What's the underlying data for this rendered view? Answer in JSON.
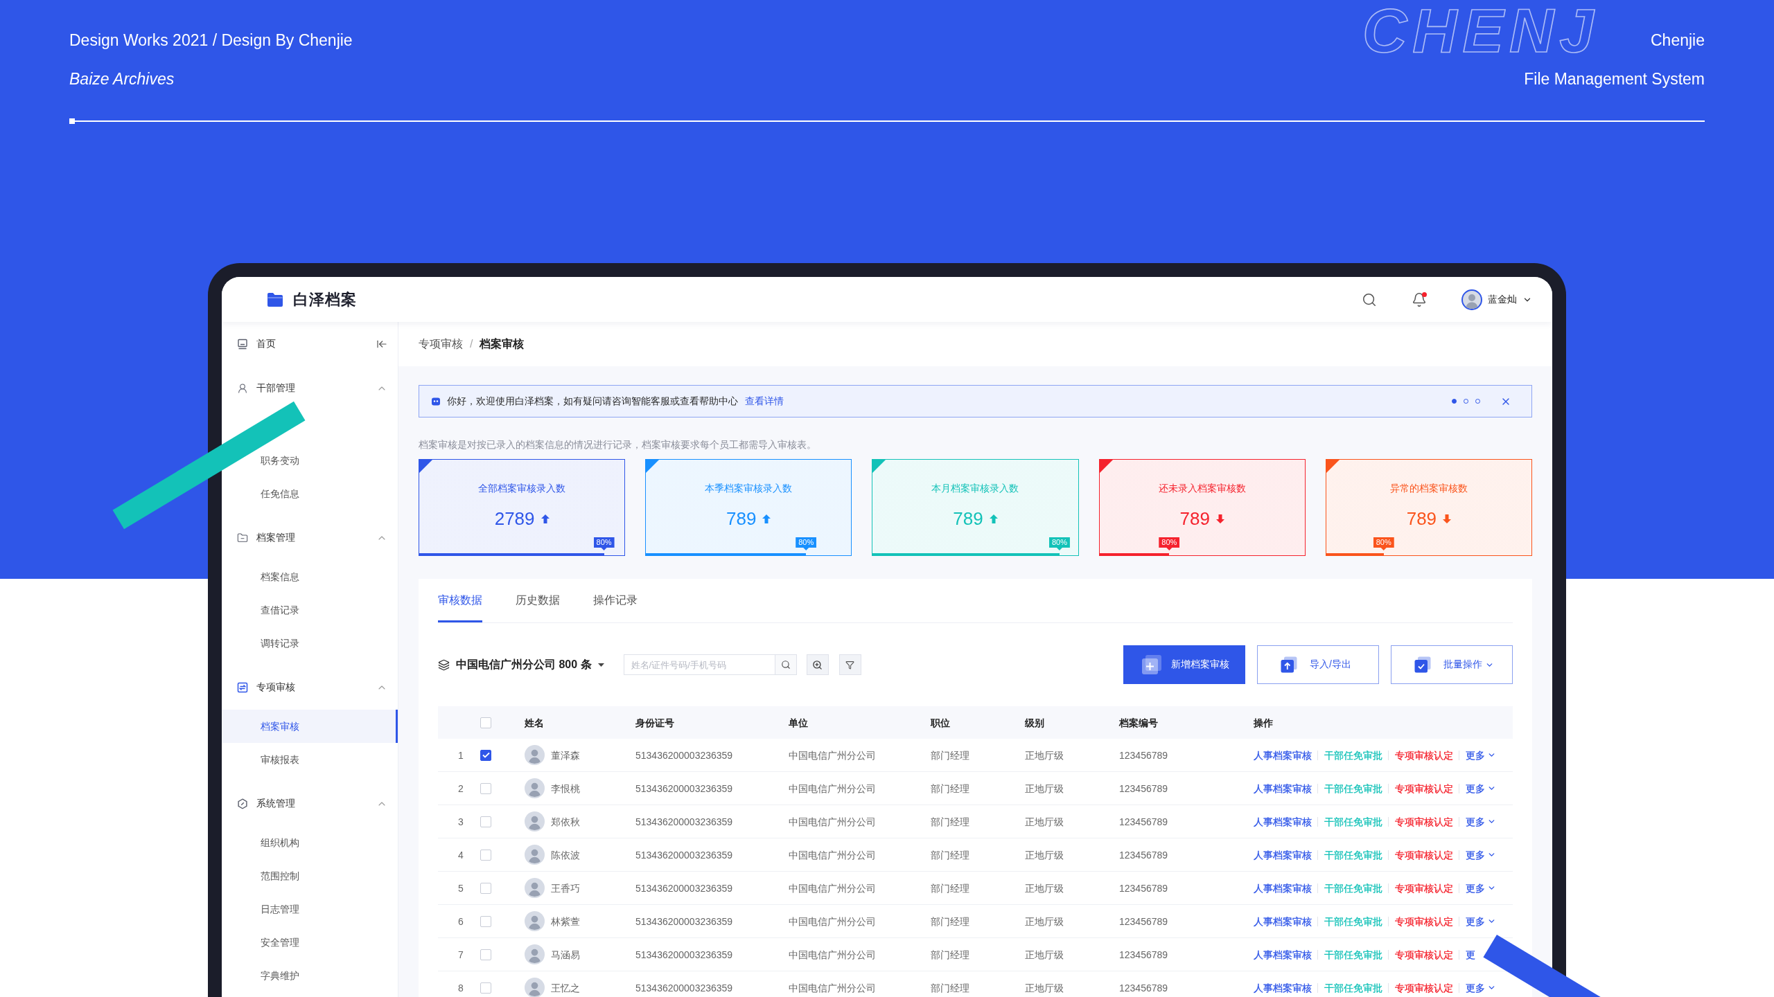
{
  "page_header": {
    "title": "Design Works 2021 / Design By Chenjie",
    "author": "Chenjie",
    "subtitle": "Baize Archives",
    "caption": "File Management System",
    "backdrop_text": "CHENJ"
  },
  "app_header": {
    "logo_text": "白泽档案",
    "has_unread": true,
    "user_name": "蓝金灿"
  },
  "sidebar": {
    "home": "首页",
    "groups": [
      {
        "label": "干部管理",
        "expanded": true,
        "children": [
          {
            "label": "职务变动",
            "selected": false
          },
          {
            "label": "任免信息",
            "selected": false
          }
        ]
      },
      {
        "label": "档案管理",
        "expanded": true,
        "children": [
          {
            "label": "档案信息",
            "selected": false
          },
          {
            "label": "查借记录",
            "selected": false
          },
          {
            "label": "调转记录",
            "selected": false
          }
        ]
      },
      {
        "label": "专项审核",
        "expanded": true,
        "children": [
          {
            "label": "档案审核",
            "selected": true
          },
          {
            "label": "审核报表",
            "selected": false
          }
        ]
      },
      {
        "label": "系统管理",
        "expanded": true,
        "children": [
          {
            "label": "组织机构",
            "selected": false
          },
          {
            "label": "范围控制",
            "selected": false
          },
          {
            "label": "日志管理",
            "selected": false
          },
          {
            "label": "安全管理",
            "selected": false
          },
          {
            "label": "字典维护",
            "selected": false
          }
        ]
      }
    ]
  },
  "breadcrumb": {
    "items": [
      "专项审核",
      "档案审核"
    ],
    "separator": "/"
  },
  "notice": {
    "text": "你好，欢迎使用白泽档案，如有疑问请咨询智能客服或查看帮助中心",
    "link": "查看详情",
    "pages": [
      {
        "selected": true
      },
      {
        "selected": false
      },
      {
        "selected": false
      }
    ]
  },
  "description": "档案审核是对按已录入的档案信息的情况进行记录，档案审核要求每个员工都需导入审核表。",
  "stats": [
    {
      "title": "全部档案审核录入数",
      "value": "2789",
      "rising": true,
      "color": "#2f56e8",
      "level": 0.9,
      "reading": "80%"
    },
    {
      "title": "本季档案审核录入数",
      "value": "789",
      "rising": true,
      "color": "#1890ff",
      "level": 0.78,
      "reading": "80%"
    },
    {
      "title": "本月档案审核录入数",
      "value": "789",
      "rising": true,
      "color": "#13c2b8",
      "level": 0.91,
      "reading": "80%"
    },
    {
      "title": "还未录入档案审核数",
      "value": "789",
      "rising": false,
      "color": "#f5222d",
      "level": 0.34,
      "reading": "80%"
    },
    {
      "title": "异常的档案审核数",
      "value": "789",
      "rising": false,
      "color": "#fa541c",
      "level": 0.28,
      "reading": "80%"
    }
  ],
  "tabs": [
    {
      "label": "审核数据",
      "selected": true
    },
    {
      "label": "历史数据",
      "selected": false
    },
    {
      "label": "操作记录",
      "selected": false
    }
  ],
  "toolbar": {
    "org": "中国电信广州分公司 800 条",
    "search": {
      "placeholder": "姓名/证件号码/手机号码"
    },
    "buttons": [
      {
        "label": "新增档案审核",
        "kind": "primary"
      },
      {
        "label": "导入/导出",
        "kind": "secondary"
      },
      {
        "label": "批量操作",
        "kind": "dropdown"
      }
    ]
  },
  "table": {
    "columns": [
      "姓名",
      "身份证号",
      "单位",
      "职位",
      "级别",
      "档案编号",
      "操作"
    ],
    "select_all": {
      "checked": false
    },
    "rows": [
      {
        "index": "1",
        "checked": true,
        "name": "董泽森",
        "id_number": "513436200003236359",
        "unit": "中国电信广州分公司",
        "position": "部门经理",
        "rank": "正地厅级",
        "file_number": "123456789",
        "actions": [
          {
            "label": "人事档案审核",
            "kind": "link",
            "color": "#2f56e8"
          },
          {
            "label": "干部任免审批",
            "kind": "link",
            "color": "#13c2b8"
          },
          {
            "label": "专项审核认定",
            "kind": "link",
            "color": "#f5222d"
          },
          {
            "label": "更多",
            "kind": "menu",
            "color": "#2f56e8"
          }
        ]
      },
      {
        "index": "2",
        "checked": false,
        "name": "李恨桃",
        "id_number": "513436200003236359",
        "unit": "中国电信广州分公司",
        "position": "部门经理",
        "rank": "正地厅级",
        "file_number": "123456789",
        "actions": [
          {
            "label": "人事档案审核",
            "kind": "link",
            "color": "#2f56e8"
          },
          {
            "label": "干部任免审批",
            "kind": "link",
            "color": "#13c2b8"
          },
          {
            "label": "专项审核认定",
            "kind": "link",
            "color": "#f5222d"
          },
          {
            "label": "更多",
            "kind": "menu",
            "color": "#2f56e8"
          }
        ]
      },
      {
        "index": "3",
        "checked": false,
        "name": "郑依秋",
        "id_number": "513436200003236359",
        "unit": "中国电信广州分公司",
        "position": "部门经理",
        "rank": "正地厅级",
        "file_number": "123456789",
        "actions": [
          {
            "label": "人事档案审核",
            "kind": "link",
            "color": "#2f56e8"
          },
          {
            "label": "干部任免审批",
            "kind": "link",
            "color": "#13c2b8"
          },
          {
            "label": "专项审核认定",
            "kind": "link",
            "color": "#f5222d"
          },
          {
            "label": "更多",
            "kind": "menu",
            "color": "#2f56e8"
          }
        ]
      },
      {
        "index": "4",
        "checked": false,
        "name": "陈依波",
        "id_number": "513436200003236359",
        "unit": "中国电信广州分公司",
        "position": "部门经理",
        "rank": "正地厅级",
        "file_number": "123456789",
        "actions": [
          {
            "label": "人事档案审核",
            "kind": "link",
            "color": "#2f56e8"
          },
          {
            "label": "干部任免审批",
            "kind": "link",
            "color": "#13c2b8"
          },
          {
            "label": "专项审核认定",
            "kind": "link",
            "color": "#f5222d"
          },
          {
            "label": "更多",
            "kind": "menu",
            "color": "#2f56e8"
          }
        ]
      },
      {
        "index": "5",
        "checked": false,
        "name": "王香巧",
        "id_number": "513436200003236359",
        "unit": "中国电信广州分公司",
        "position": "部门经理",
        "rank": "正地厅级",
        "file_number": "123456789",
        "actions": [
          {
            "label": "人事档案审核",
            "kind": "link",
            "color": "#2f56e8"
          },
          {
            "label": "干部任免审批",
            "kind": "link",
            "color": "#13c2b8"
          },
          {
            "label": "专项审核认定",
            "kind": "link",
            "color": "#f5222d"
          },
          {
            "label": "更多",
            "kind": "menu",
            "color": "#2f56e8"
          }
        ]
      },
      {
        "index": "6",
        "checked": false,
        "name": "林紫萱",
        "id_number": "513436200003236359",
        "unit": "中国电信广州分公司",
        "position": "部门经理",
        "rank": "正地厅级",
        "file_number": "123456789",
        "actions": [
          {
            "label": "人事档案审核",
            "kind": "link",
            "color": "#2f56e8"
          },
          {
            "label": "干部任免审批",
            "kind": "link",
            "color": "#13c2b8"
          },
          {
            "label": "专项审核认定",
            "kind": "link",
            "color": "#f5222d"
          },
          {
            "label": "更多",
            "kind": "menu",
            "color": "#2f56e8"
          }
        ]
      },
      {
        "index": "7",
        "checked": false,
        "name": "马涵易",
        "id_number": "513436200003236359",
        "unit": "中国电信广州分公司",
        "position": "部门经理",
        "rank": "正地厅级",
        "file_number": "123456789",
        "actions": [
          {
            "label": "人事档案审核",
            "kind": "link",
            "color": "#2f56e8"
          },
          {
            "label": "干部任免审批",
            "kind": "link",
            "color": "#13c2b8"
          },
          {
            "label": "专项审核认定",
            "kind": "link",
            "color": "#f5222d"
          },
          {
            "label": "更",
            "kind": "link",
            "color": "#2f56e8"
          }
        ]
      },
      {
        "index": "8",
        "checked": false,
        "name": "王忆之",
        "id_number": "513436200003236359",
        "unit": "中国电信广州分公司",
        "position": "部门经理",
        "rank": "正地厅级",
        "file_number": "123456789",
        "actions": [
          {
            "label": "人事档案审核",
            "kind": "link",
            "color": "#2f56e8"
          },
          {
            "label": "干部任免审批",
            "kind": "link",
            "color": "#13c2b8"
          },
          {
            "label": "专项审核认定",
            "kind": "link",
            "color": "#f5222d"
          },
          {
            "label": "更多",
            "kind": "menu",
            "color": "#2f56e8"
          }
        ]
      }
    ]
  }
}
